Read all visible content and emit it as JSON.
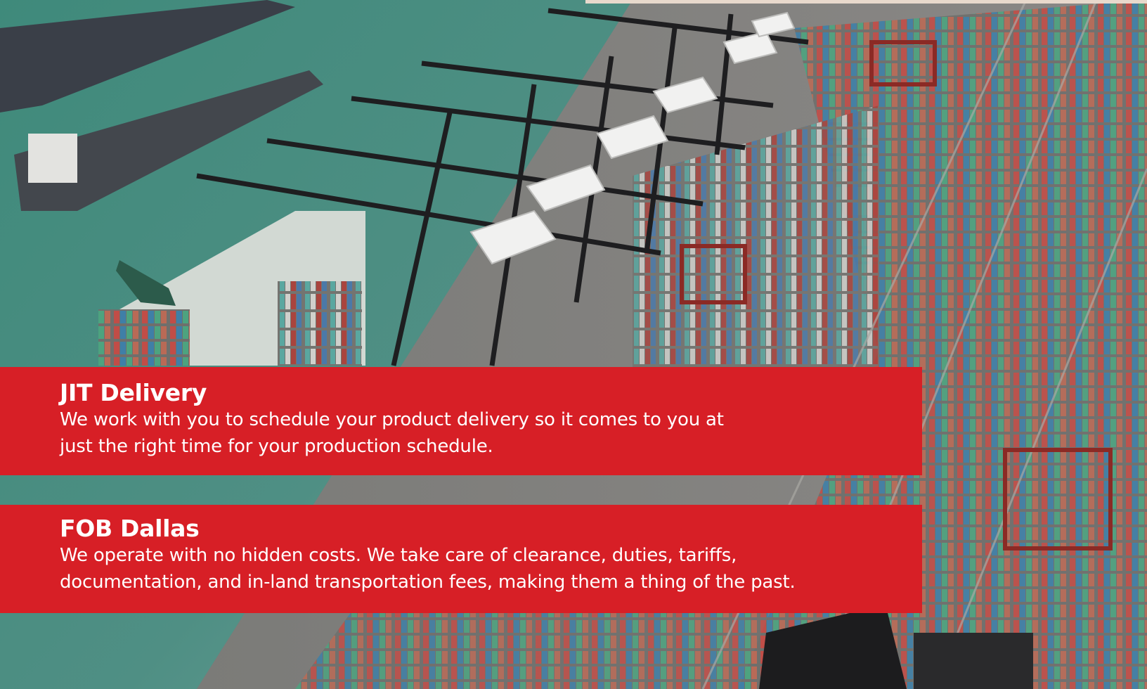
{
  "colors": {
    "card_bg": "#d71f26",
    "card_text": "#ffffff"
  },
  "background": {
    "icon": "container-port-photo"
  },
  "features": [
    {
      "title": "JIT Delivery",
      "lines": [
        "We work with you to schedule your product delivery so it comes to you at",
        "just the right time for your production schedule."
      ]
    },
    {
      "title": "FOB Dallas",
      "lines": [
        "We operate with no hidden costs. We take care of clearance, duties, tariffs,",
        "documentation, and in-land transportation fees, making them a thing of the past."
      ]
    }
  ]
}
